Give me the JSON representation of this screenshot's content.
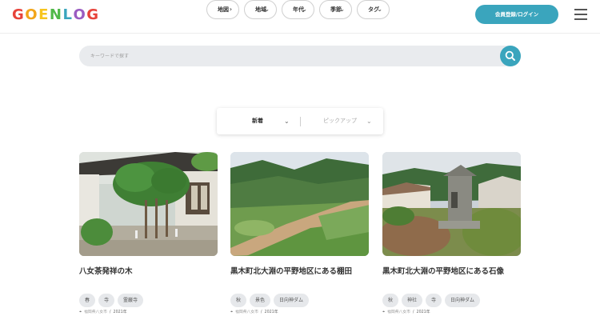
{
  "header": {
    "logo_text": "GOENLOG",
    "logo_colors": [
      "#e7433a",
      "#f2a51a",
      "#f7c51e",
      "#4fb848",
      "#3aa5bd",
      "#9a5cc1",
      "#e7433a"
    ],
    "login_label": "会員登録/ログイン",
    "menu_icon": "hamburger-icon"
  },
  "search": {
    "placeholder": "キーワードで探す",
    "button_icon": "search-icon"
  },
  "filters": [
    {
      "label": "地図",
      "icon": "chevron-right-icon"
    },
    {
      "label": "地域",
      "icon": "chevron-down-icon"
    },
    {
      "label": "年代",
      "icon": "chevron-down-icon"
    },
    {
      "label": "季節",
      "icon": "chevron-down-icon"
    },
    {
      "label": "タグ",
      "icon": "chevron-down-icon"
    }
  ],
  "sort": {
    "selected": "新着",
    "other": "ピックアップ"
  },
  "colors": {
    "accent": "#3aa5bd",
    "tag_bg": "#e6e8eb"
  },
  "cards": [
    {
      "title": "八女茶発祥の木",
      "tags": [
        "春",
        "寺",
        "霊巌寺"
      ],
      "location": "福岡県八女市",
      "year": "2021年"
    },
    {
      "title": "黒木町北大淵の平野地区にある棚田",
      "tags": [
        "秋",
        "景色",
        "日向神ダム"
      ],
      "location": "福岡県八女市",
      "year": "2021年"
    },
    {
      "title": "黒木町北大淵の平野地区にある石像",
      "tags": [
        "秋",
        "神社",
        "寺",
        "日向神ダム"
      ],
      "location": "福岡県八女市",
      "year": "2021年"
    }
  ]
}
